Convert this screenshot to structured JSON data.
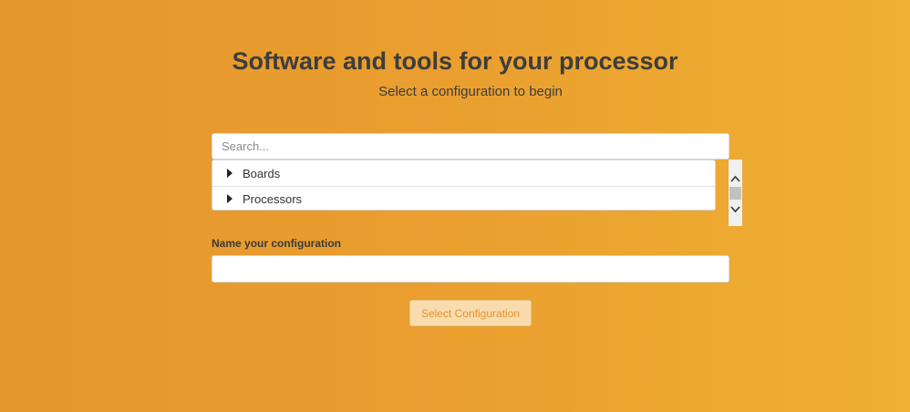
{
  "header": {
    "title": "Software and tools for your processor",
    "subtitle": "Select a configuration to begin"
  },
  "search": {
    "placeholder": "Search...",
    "value": ""
  },
  "tree": {
    "items": [
      {
        "label": "Boards",
        "icon": "caret-right-icon",
        "expanded": false
      },
      {
        "label": "Processors",
        "icon": "caret-right-icon",
        "expanded": false
      }
    ]
  },
  "config_name": {
    "label": "Name your configuration",
    "value": ""
  },
  "actions": {
    "select_label": "Select Configuration"
  },
  "colors": {
    "background_start": "#e5962c",
    "background_end": "#efb033",
    "button_bg": "#f8dcae",
    "button_text": "#e5922c"
  }
}
